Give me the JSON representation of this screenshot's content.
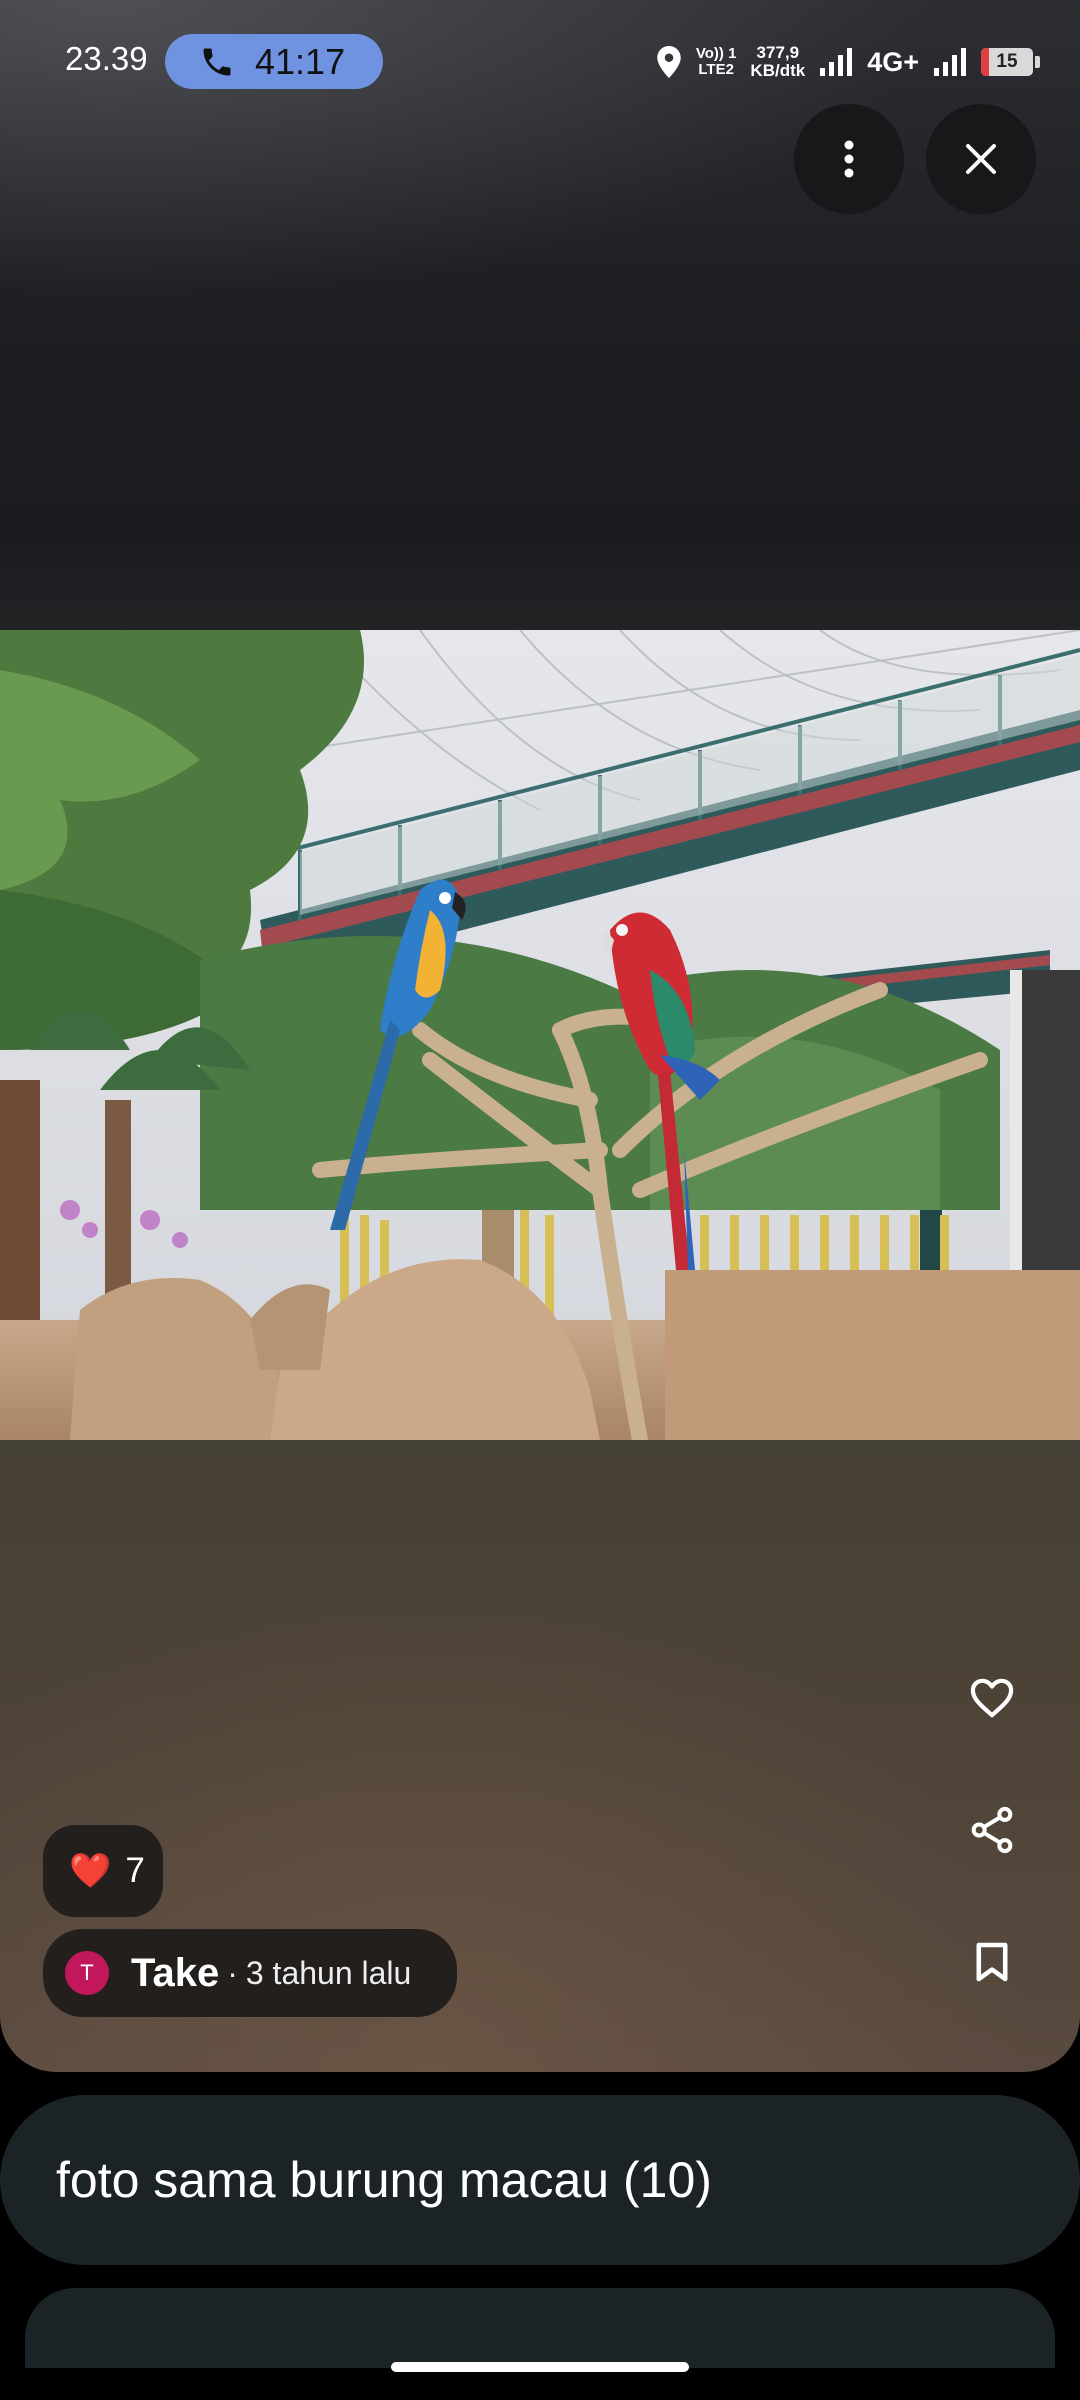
{
  "status_bar": {
    "time": "23.39",
    "call_timer": "41:17",
    "volte_top": "Vo)) 1",
    "volte_bottom": "LTE2",
    "speed_value": "377,9",
    "speed_unit": "KB/dtk",
    "network": "4G+",
    "battery": "15",
    "battery_level": 0.15
  },
  "post": {
    "reaction_emoji": "❤️",
    "reaction_count": "7",
    "author_initial": "T",
    "author_name": "Take",
    "separator": "·",
    "posted_time": "3 tahun lalu"
  },
  "album": {
    "title": "foto sama burung macau (10)"
  },
  "icons": {
    "call": "phone-icon",
    "location": "location-pin-icon",
    "more": "more-vert-icon",
    "close": "close-icon",
    "like": "heart-outline-icon",
    "share": "share-icon",
    "save": "bookmark-icon"
  },
  "colors": {
    "call_pill": "#6f93e0",
    "avatar": "#c2185b",
    "battery_low": "#e04040"
  }
}
